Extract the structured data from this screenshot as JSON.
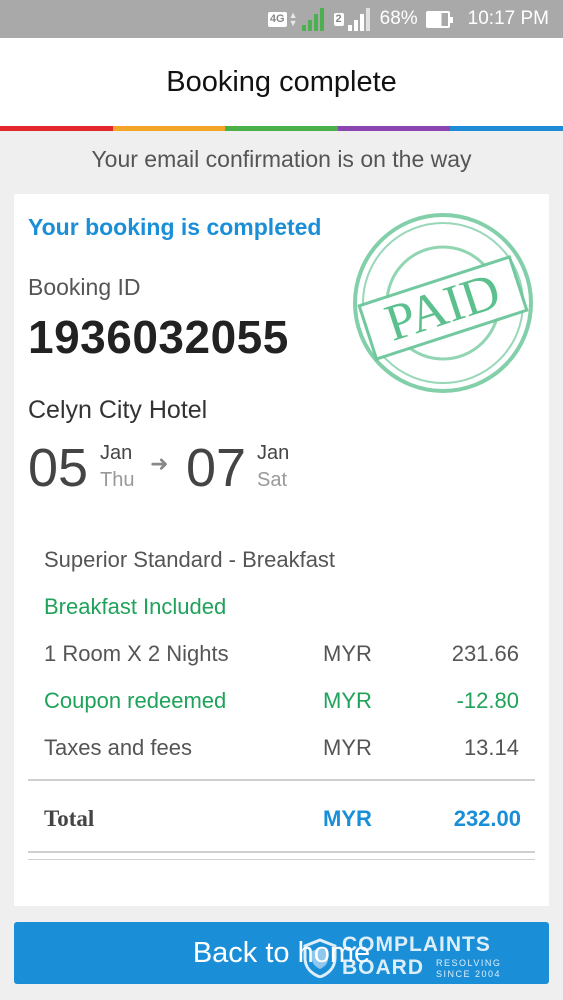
{
  "status_bar": {
    "network": "4G",
    "sim": "2",
    "battery": "68%",
    "time": "10:17 PM"
  },
  "header": {
    "title": "Booking complete",
    "rainbow_colors": [
      "#e3262b",
      "#f2a527",
      "#49b04a",
      "#8a45b0",
      "#1f8ad6"
    ]
  },
  "email_message": "Your email confirmation is on the way",
  "booking": {
    "status_title": "Your booking is completed",
    "id_label": "Booking ID",
    "id": "1936032055",
    "stamp": "PAID",
    "hotel": "Celyn City Hotel",
    "checkin": {
      "day": "05",
      "month": "Jan",
      "weekday": "Thu"
    },
    "checkout": {
      "day": "07",
      "month": "Jan",
      "weekday": "Sat"
    },
    "arrow_icon": "arrow-right-icon"
  },
  "room": {
    "name": "Superior Standard - Breakfast",
    "breakfast": "Breakfast Included"
  },
  "lines": [
    {
      "label": "1 Room X 2 Nights",
      "currency": "MYR",
      "amount": "231.66"
    },
    {
      "label": "Coupon redeemed",
      "currency": "MYR",
      "amount": "-12.80"
    },
    {
      "label": "Taxes and fees",
      "currency": "MYR",
      "amount": "13.14"
    }
  ],
  "total": {
    "label": "Total",
    "currency": "MYR",
    "amount": "232.00"
  },
  "footer": {
    "button": "Back to home",
    "watermark_big1": "COMPLAINTS",
    "watermark_big2": "BOARD",
    "watermark_small1": "RESOLVING",
    "watermark_small2": "SINCE 2004"
  },
  "colors": {
    "accent_blue": "#1a8fd8",
    "green": "#1fa25a",
    "stamp_green": "#4dbb86"
  }
}
